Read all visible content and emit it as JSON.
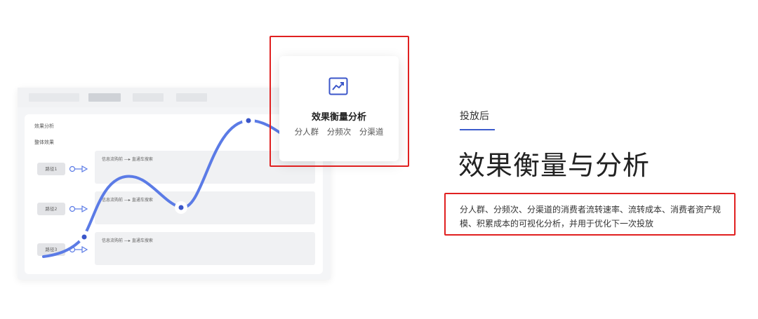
{
  "dashboard": {
    "section_label": "效果分析",
    "subsection_label": "整体效果",
    "paths": [
      {
        "label": "路径1",
        "flow": "信息流购前 —▸ 直通车搜索"
      },
      {
        "label": "路径2",
        "flow": "信息流购前 —▸ 直通车搜索"
      },
      {
        "label": "路径3",
        "flow": "信息流购前 —▸ 直通车搜索"
      }
    ],
    "curve_color": "#5b7be6",
    "point_color": "#3b56c9"
  },
  "card": {
    "icon": "trend-chart-icon",
    "title": "效果衡量分析",
    "tags": [
      "分人群",
      "分频次",
      "分渠道"
    ],
    "accent_color": "#3b56c9"
  },
  "right": {
    "stage": "投放后",
    "title": "效果衡量与分析",
    "description": "分人群、分频次、分渠道的消费者流转速率、流转成本、消费者资产规模、积累成本的可视化分析，并用于优化下一次投放"
  },
  "highlight_color": "#e02020"
}
